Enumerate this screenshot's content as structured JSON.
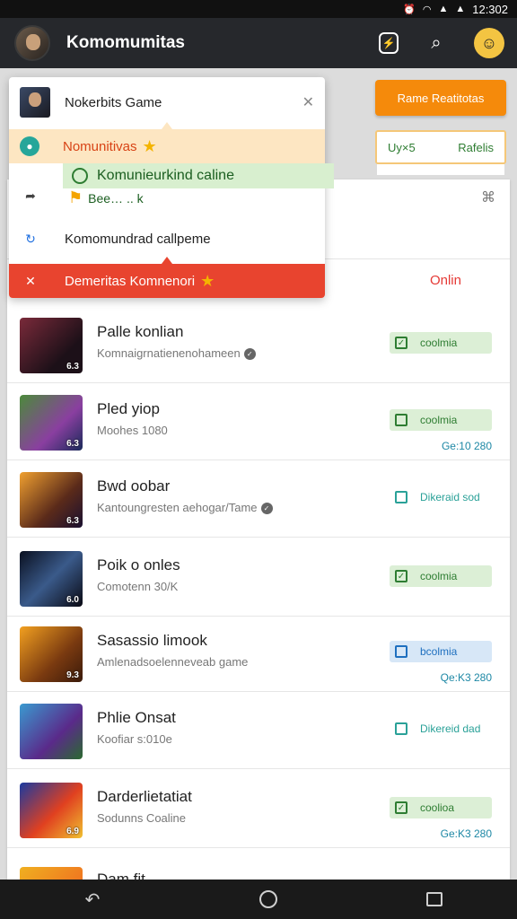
{
  "status": {
    "time": "12:302"
  },
  "app_bar": {
    "title": "Komomumitas",
    "badge_icon": "lightning-icon",
    "search_icon": "search-icon"
  },
  "orange_button": "Rame Reatitotas",
  "tab_card": {
    "left": "Uy×5",
    "right": "Rafelis"
  },
  "popup": {
    "title": "Nokerbits Game",
    "row_orange": "Nomunitivas",
    "green_tip": "Komunieurkind caline",
    "green_sub": "Bee… .. k",
    "row_plain1": "",
    "row_plain2": "Komomundrad callpeme",
    "row_red": "Demeritas Komnenori"
  },
  "list": {
    "online_label": "Onlin",
    "games": [
      {
        "name": "Palle konlian",
        "sub": "Komnaigrnatienenohameen",
        "rating": "6.3",
        "btn": "coolmia",
        "btn_style": "green",
        "time": ""
      },
      {
        "name": "Pled yiop",
        "sub": "Moohes 1080",
        "rating": "6.3",
        "btn": "coolmia",
        "btn_style": "green",
        "time": "Ge:10 280"
      },
      {
        "name": "Bwd oobar",
        "sub": "Kantoungresten aehogar/Tame",
        "rating": "6.3",
        "btn": "Dikeraid sod",
        "btn_style": "plain",
        "time": ""
      },
      {
        "name": "Poik o onles",
        "sub": "Comotenn 30/K",
        "rating": "6.0",
        "btn": "coolmia",
        "btn_style": "green",
        "time": ""
      },
      {
        "name": "Sasassio limook",
        "sub": "Amlenadsoelenneveab game",
        "rating": "9.3",
        "btn": "bcolmia",
        "btn_style": "blue",
        "time": "Qe:K3 280"
      },
      {
        "name": "Phlie Onsat",
        "sub": "Koofiar s:010e",
        "rating": "",
        "btn": "Dikereid dad",
        "btn_style": "plain",
        "time": ""
      },
      {
        "name": "Darderlietatiat",
        "sub": "Sodunns Coaline",
        "rating": "6.9",
        "btn": "coolioa",
        "btn_style": "green",
        "time": "Ge:K3 280"
      },
      {
        "name": "Dam.fit",
        "sub": "",
        "rating": "",
        "btn": "",
        "btn_style": "",
        "time": ""
      }
    ]
  }
}
